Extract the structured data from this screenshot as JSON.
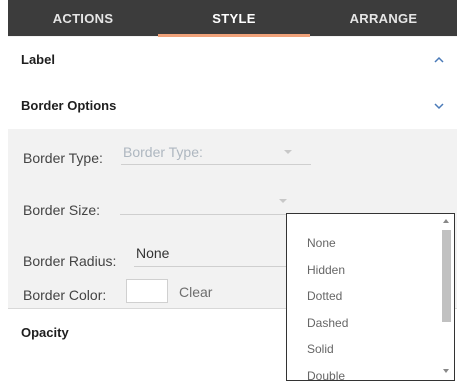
{
  "tabs": [
    {
      "label": "ACTIONS"
    },
    {
      "label": "STYLE"
    },
    {
      "label": "ARRANGE"
    }
  ],
  "sections": {
    "label": {
      "title": "Label",
      "expanded": false
    },
    "border_options": {
      "title": "Border Options",
      "expanded": true
    },
    "opacity": {
      "title": "Opacity"
    }
  },
  "border": {
    "type_label": "Border Type:",
    "type_placeholder": "Border Type:",
    "size_label": "Border Size:",
    "radius_label": "Border Radius:",
    "radius_value": "None",
    "color_label": "Border Color:",
    "clear_label": "Clear"
  },
  "dropdown": {
    "options": [
      "None",
      "Hidden",
      "Dotted",
      "Dashed",
      "Solid",
      "Double"
    ]
  },
  "colors": {
    "tab_bar": "#3c3c3c",
    "accent": "#f0a27a",
    "placeholder": "#aeb7c0"
  }
}
